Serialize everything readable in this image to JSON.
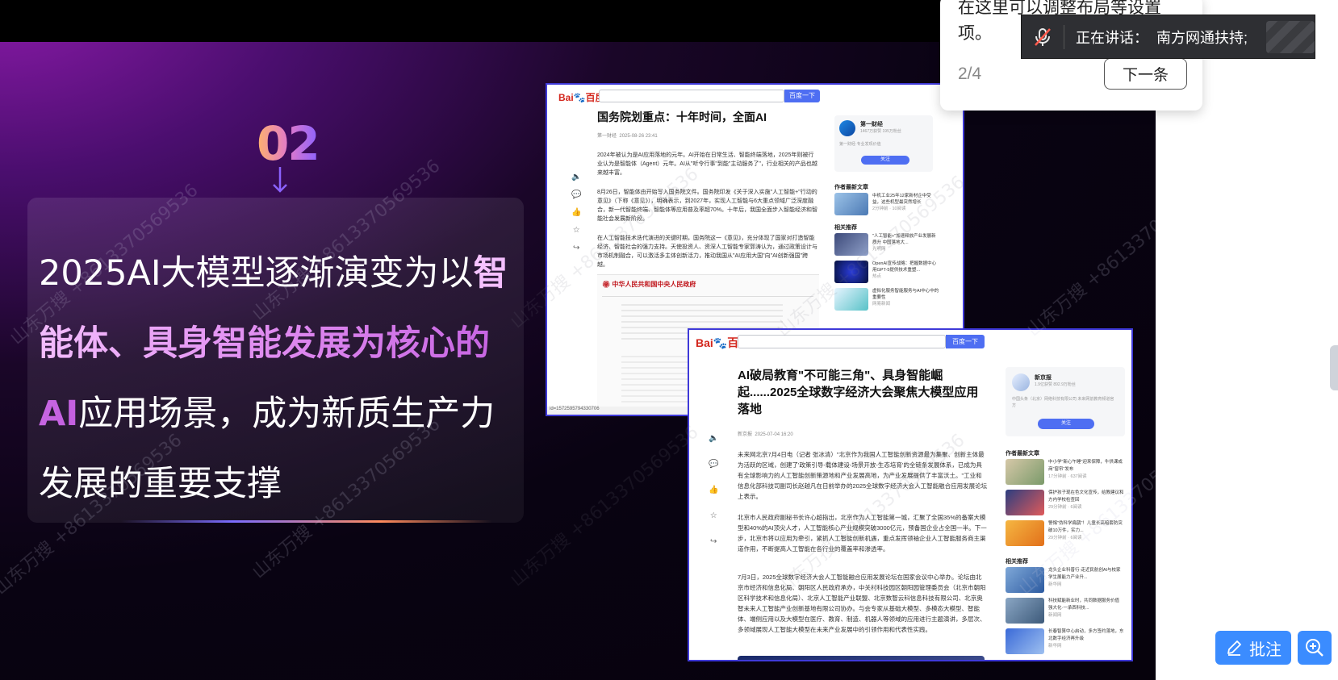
{
  "slide": {
    "step_number": "02",
    "headline_parts": [
      {
        "text": "2025AI大模型逐渐演变为以",
        "highlight": false
      },
      {
        "text": "智能体、具身智能发展为核心的AI",
        "highlight": true
      },
      {
        "text": "应用场景，成为新质生产力发展的重要支撑",
        "highlight": false
      }
    ]
  },
  "article1": {
    "logo_text_red": "Bai",
    "logo_text_blue": "度",
    "logo_suffix": "百度",
    "search_button": "百度一下",
    "title": "国务院划重点：十年时间，全面AI",
    "meta_source": "第一财经",
    "meta_time": "2025-08-26 23:41",
    "paragraphs": [
      "2024年被认为是AI应用落地的元年。AI开始在日常生活、智能终端落地，2025年则被行业认为是智能体（Agent）元年。AI从\"听令行事\"到能\"主动服务了\"，行业相关的产品也越来越丰富。",
      "8月26日，智能体由开始写入国务院文件。国务院印发《关于深入实施\"人工智能+\"行动的意见》（下称《意见》），明确表示，到2027年，实现人工智能与6大重点领域广泛深度融合，新一代智能终端、智能体等应用普及率超70%。十年后，我国全面步入智能经济和智能社会发展新阶段。",
      "在人工智能技术迭代演进的关键时期，国务院这一《意见》，充分体现了国家对打造智能经济、智能社会的强力支持。天使投资人、资深人工智能专家郭涛认为，通过政策设计与市场机制融合，可以激活多主体创新活力，推动我国从\"AI应用大国\"向\"AI创新强国\"跨越。"
    ],
    "gov_banner": "中华人民共和国中央人民政府",
    "author_name": "第一财经",
    "author_stats": "1467万获赞 195万粉丝",
    "author_desc": "第一财经·专业发现价值",
    "follow": "关注",
    "latest_title": "作者最新文章",
    "latest_items": [
      {
        "text": "中机工业25年12家新材企中受益，这些机型最突然增长",
        "sub": "2分钟前 · 10阅读"
      }
    ],
    "related_title": "相关推荐",
    "related_items": [
      {
        "text": "\"人工智能+\"加速释放产业发展新质升 中国落地大...",
        "sub": "光明网"
      },
      {
        "text": "OpenAI宣传战略：把握数据中心用GPT-5提供技术重塑...",
        "sub": "热点"
      },
      {
        "text": "虚拟化服务智能服务与AI中心中的重要性",
        "sub": "网易新闻"
      }
    ],
    "side_labels": [
      "播报",
      "评论",
      "点赞",
      "收藏",
      "分享"
    ],
    "url_footer": "id=1572595794330706"
  },
  "article2": {
    "search_button": "百度一下",
    "title": "AI破局教育\"不可能三角\"、具身智能崛起......2025全球数字经济大会聚焦大模型应用落地",
    "meta_source": "新京报",
    "meta_time": "2025-07-04 16:20",
    "paragraphs": [
      "未来网北京7月4日电（记者 张冰清）\"北京作为我国人工智能创新资源最为集聚、创新主体最为活跃的区域，创建了'政策引导-载体建设-场景开放-生态培育'的全链条发展体系，已成为具有全球影响力的人工智能创新策源地和产业发展高地，为产业发展提供了丰富沃土。\"工业和信息化部科技司副司长赵越凡在日前举办的2025全球数字经济大会人工智能融合应用发展论坛上表示。",
      "北京市人民政府副秘书长许心超指出，北京作为人工智能第一城，汇聚了全国35%的备案大模型和40%的AI顶尖人才，人工智能核心产业规模突破3000亿元，预备国企业占全国一半。下一步，北京市将以应用为牵引，紧抓人工智能创新机遇，重点发挥领袖企业人工智能服务商主渠道作用，不断提高人工智能在各行业的覆盖率和渗透率。",
      "7月3日，2025全球数字经济大会人工智能融合应用发展论坛在国家会议中心举办。论坛由北京市经济和信息化局、朝阳区人民政府承办，中关村科技园区朝阳园管理委员会（北京市朝阳区科学技术和信息化局）、北京人工智能产业联盟、北京数智云科信息科技有限公司、北京奥智未来人工智能产业创新基地有限公司协办。与会专家从基础大模型、多模态大模型、智能体、端侧应用以及大模型在医疗、教育、制造、机器人等领域的应用进行主题演讲，多层次、多领域展现人工智能大模型在未来产业发展中的引领作用和代表性实践。"
    ],
    "author_name": "新京报",
    "author_stats": "1.9亿获赞 892.9万粉丝",
    "author_desc": "中国头条（北京）网络科技有限公司 未来网前教育频道官方",
    "follow": "关注",
    "latest_title": "作者最新文章",
    "latest_items": [
      {
        "text": "中小学\"新心午睡\"迎来保障，牛供课成商\"窗帘\"发布",
        "sub": "17分钟前 · 637阅读"
      },
      {
        "text": "保护孩子现在色文化宣传，给教建议和方内学校检查回",
        "sub": "29分钟前 · 6阅读"
      },
      {
        "text": "警惕\"伪科学扁鹊\"！儿童长高暗套防突破10万件，实力...",
        "sub": "29分钟前 · 6阅读"
      }
    ],
    "related_title": "相关推荐",
    "related_items": [
      {
        "text": "龙头企业科普行·走近民航创AI与校家学生展能力产业升...",
        "sub": "新华网"
      },
      {
        "text": "科技赋能新业时，共同数据服务价值 强大化·一承西科技...",
        "sub": "新闻网"
      },
      {
        "text": "长春智算中心启动，多方签约落地，东北数字经济再升级",
        "sub": "新华网"
      }
    ],
    "side_labels": [
      "播报",
      "评论",
      "点赞",
      "收藏",
      "分享"
    ]
  },
  "popover": {
    "text": "在这里可以调整布局等设置项。",
    "count": "2/4",
    "next_button": "下一条"
  },
  "speaker_bar": {
    "label": "正在讲话：",
    "name": "南方网通扶持;"
  },
  "buttons": {
    "annotate": "批注"
  },
  "watermark": "山东万搜 +8613370569536",
  "colors": {
    "accent_blue": "#3b8cff",
    "baidu_blue": "#4e6ef2",
    "highlight_pink": "#e08cf0"
  }
}
